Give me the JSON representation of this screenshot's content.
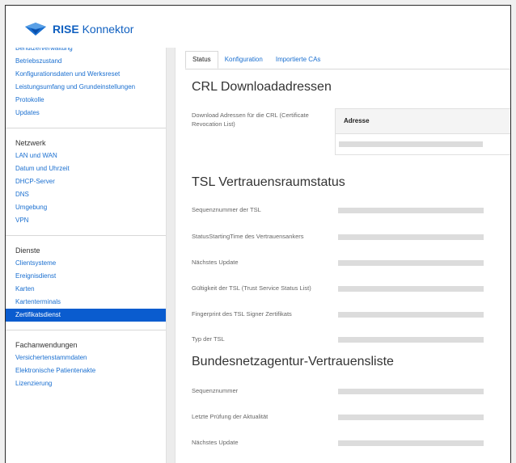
{
  "app": {
    "logo_bold": "RISE",
    "logo_rest": " Konnektor"
  },
  "sidebar": {
    "top_items": [
      "Benutzerverwaltung",
      "Betriebszustand",
      "Konfigurationsdaten und Werksreset",
      "Leistungsumfang und Grundeinstellungen",
      "Protokolle",
      "Updates"
    ],
    "netzwerk": {
      "heading": "Netzwerk",
      "items": [
        "LAN und WAN",
        "Datum und Uhrzeit",
        "DHCP-Server",
        "DNS",
        "Umgebung",
        "VPN"
      ]
    },
    "dienste": {
      "heading": "Dienste",
      "items": [
        "Clientsysteme",
        "Ereignisdienst",
        "Karten",
        "Kartenterminals",
        "Zertifikatsdienst"
      ],
      "active": "Zertifikatsdienst"
    },
    "fachanwendungen": {
      "heading": "Fachanwendungen",
      "items": [
        "Versichertenstammdaten",
        "Elektronische Patientenakte",
        "Lizenzierung"
      ]
    }
  },
  "tabs": [
    {
      "label": "Status",
      "active": true
    },
    {
      "label": "Konfiguration",
      "active": false
    },
    {
      "label": "Importierte CAs",
      "active": false
    }
  ],
  "crl": {
    "title": "CRL Downloadadressen",
    "label": "Download Adressen für die CRL (Certificate Revocation List)",
    "column_header": "Adresse"
  },
  "tsl": {
    "title": "TSL Vertrauensraumstatus",
    "rows": [
      "Sequenznummer der TSL",
      "StatusStartingTime des Vertrauensankers",
      "Nächstes Update",
      "Gültigkeit der TSL (Trust Service Status List)",
      "Fingerprint des TSL Signer Zertifikats",
      "Typ der TSL"
    ]
  },
  "bnetza": {
    "title": "Bundesnetzagentur-Vertrauensliste",
    "rows": [
      "Sequenznummer",
      "Letzte Prüfung der Aktualität",
      "Nächstes Update"
    ]
  },
  "colors": {
    "accent": "#0a5ccf",
    "link": "#1a6fd0"
  }
}
